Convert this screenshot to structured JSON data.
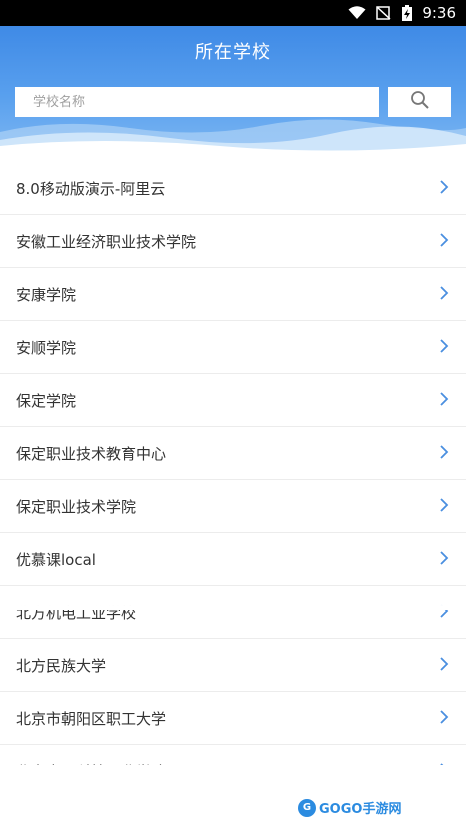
{
  "status_bar": {
    "time": "9:36"
  },
  "header": {
    "title": "所在学校"
  },
  "search": {
    "placeholder": "学校名称",
    "value": ""
  },
  "schools": [
    "8.0移动版演示-阿里云",
    "安徽工业经济职业技术学院",
    "安康学院",
    "安顺学院",
    "保定学院",
    "保定职业技术教育中心",
    "保定职业技术学院",
    "优慕课local",
    "北方机电工业学校",
    "北方民族大学",
    "北京市朝阳区职工大学",
    "北京电子科技职业学院"
  ],
  "watermark": {
    "brand": "GOGO手游网"
  },
  "colors": {
    "header": "#4a93ea",
    "chevron": "#4a8fe0",
    "text": "#333333"
  }
}
